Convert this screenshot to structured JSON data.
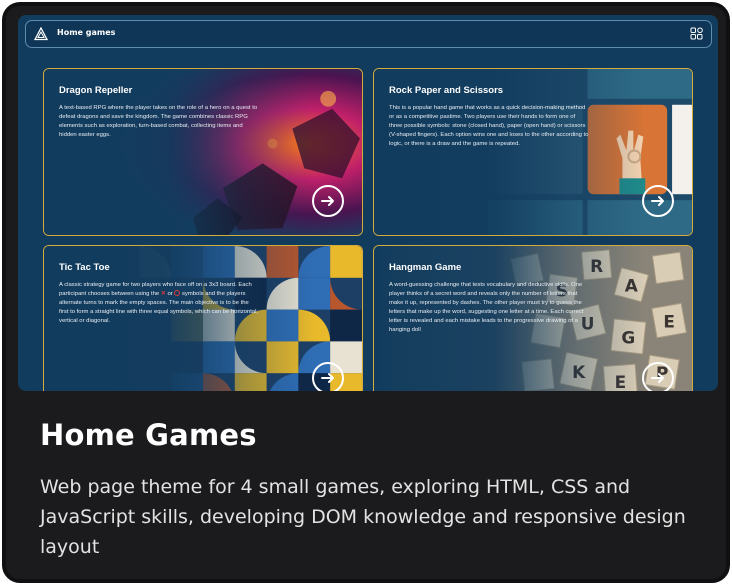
{
  "header": {
    "title": "Home games",
    "logo_icon": "triangle-logo-icon",
    "menu_icon": "grid-icon"
  },
  "games": [
    {
      "title": "Dragon Repeller",
      "description": "A text-based RPG where the player takes on the role of a hero on a quest to defeat dragons and save the kingdom. The game combines classic RPG elements such as exploration, turn-based combat, collecting items and hidden easter eggs.",
      "button_icon": "arrow-right-circle-icon"
    },
    {
      "title": "Rock Paper and Scissors",
      "description": "This is a popular hand game that works as a quick decision-making method or as a competitive pastime. Two players use their hands to form one of three possible symbols: stone (closed hand), paper (open hand) or scissors (V-shaped fingers). Each option wins one and loses to the other according to logic, or there is a draw and the game is repeated.",
      "button_icon": "arrow-right-circle-icon"
    },
    {
      "title": "Tic Tac Toe",
      "description_before": "A classic strategy game for two players who face off on a 3x3 board. Each participant chooses between using the",
      "symbol_x": "✕",
      "description_or": "or",
      "description_after": "symbols and the players alternate turns to mark the empty spaces. The main objective is to be the first to form a straight line with three equal symbols, which can be horizontal, vertical or diagonal.",
      "button_icon": "arrow-right-circle-icon"
    },
    {
      "title": "Hangman Game",
      "description": "A word-guessing challenge that tests vocabulary and deductive skills. One player thinks of a secret word and reveals only the number of letters that make it up, represented by dashes. The other player must try to guess the letters that make up the word, suggesting one letter at a time. Each correct letter is revealed and each mistake leads to the progressive drawing of a hanging doll",
      "button_icon": "arrow-right-circle-icon"
    }
  ],
  "caption": {
    "title": "Home Games",
    "description": "Web page theme for 4 small games, exploring HTML, CSS and JavaScript skills, developing DOM knowledge and responsive design layout"
  },
  "colors": {
    "card_background": "#1b1b1d",
    "screen_background": "#123c5e",
    "tile_border": "#d5ac3b",
    "symbol_red": "#e0393a"
  }
}
